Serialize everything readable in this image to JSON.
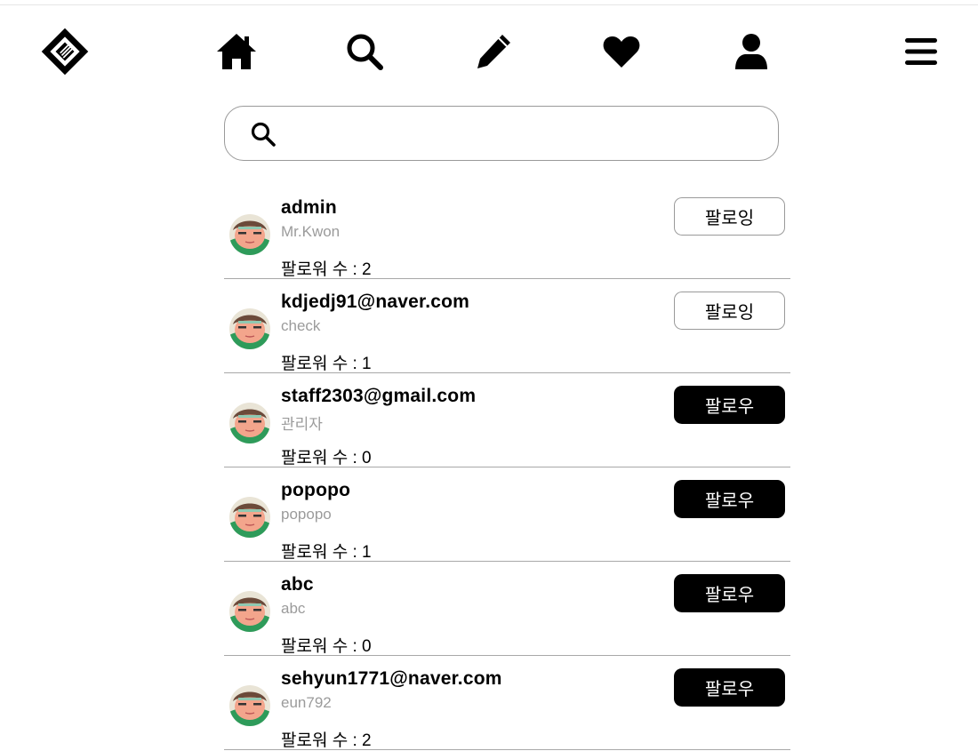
{
  "nav": {
    "logo_icon": "diamond-logo-icon",
    "items": [
      {
        "name": "home",
        "icon": "home-icon"
      },
      {
        "name": "search",
        "icon": "search-icon"
      },
      {
        "name": "write",
        "icon": "pen-icon"
      },
      {
        "name": "likes",
        "icon": "heart-icon"
      },
      {
        "name": "profile",
        "icon": "user-icon"
      },
      {
        "name": "menu",
        "icon": "hamburger-menu-icon"
      }
    ]
  },
  "search": {
    "placeholder": "",
    "value": ""
  },
  "users": [
    {
      "username": "admin",
      "nickname": "Mr.Kwon",
      "followers": "팔로워 수 : 2",
      "button": "팔로잉",
      "state": "following"
    },
    {
      "username": "kdjedj91@naver.com",
      "nickname": "check",
      "followers": "팔로워 수 : 1",
      "button": "팔로잉",
      "state": "following"
    },
    {
      "username": "staff2303@gmail.com",
      "nickname": "관리자",
      "followers": "팔로워 수 : 0",
      "button": "팔로우",
      "state": "follow"
    },
    {
      "username": "popopo",
      "nickname": "popopo",
      "followers": "팔로워 수 : 1",
      "button": "팔로우",
      "state": "follow"
    },
    {
      "username": "abc",
      "nickname": "abc",
      "followers": "팔로워 수 : 0",
      "button": "팔로우",
      "state": "follow"
    },
    {
      "username": "sehyun1771@naver.com",
      "nickname": "eun792",
      "followers": "팔로워 수 : 2",
      "button": "팔로우",
      "state": "follow"
    }
  ],
  "colors": {
    "follow_bg": "#000000",
    "following_border": "#9a9a9a",
    "nickname": "#9b9b9b"
  }
}
